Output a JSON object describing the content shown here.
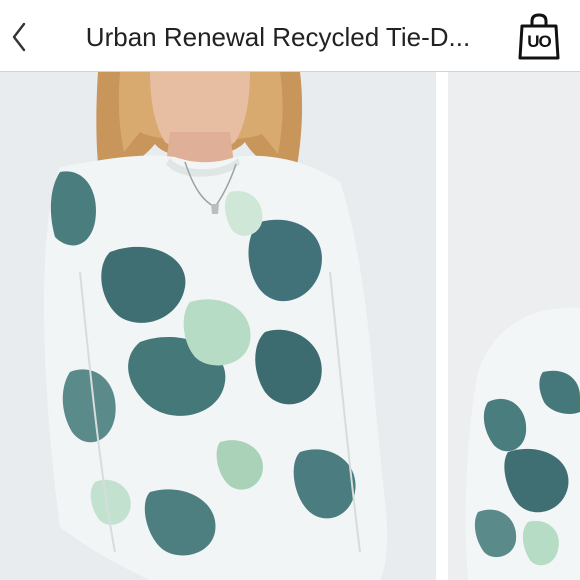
{
  "header": {
    "title": "Urban Renewal Recycled Tie-D...",
    "bag_logo_text": "UO"
  },
  "icons": {
    "back": "chevron-left-icon",
    "bag": "shopping-bag-icon"
  },
  "colors": {
    "header_bg": "#ffffff",
    "photo_bg": "#e9ecee",
    "dye_teal": "#3f6f72",
    "dye_mint": "#a9d2b8"
  },
  "gallery": {
    "photos": [
      {
        "subject": "model wearing tie-dye sweatshirt"
      },
      {
        "subject": "tie-dye sweatshirt partial view"
      }
    ]
  }
}
